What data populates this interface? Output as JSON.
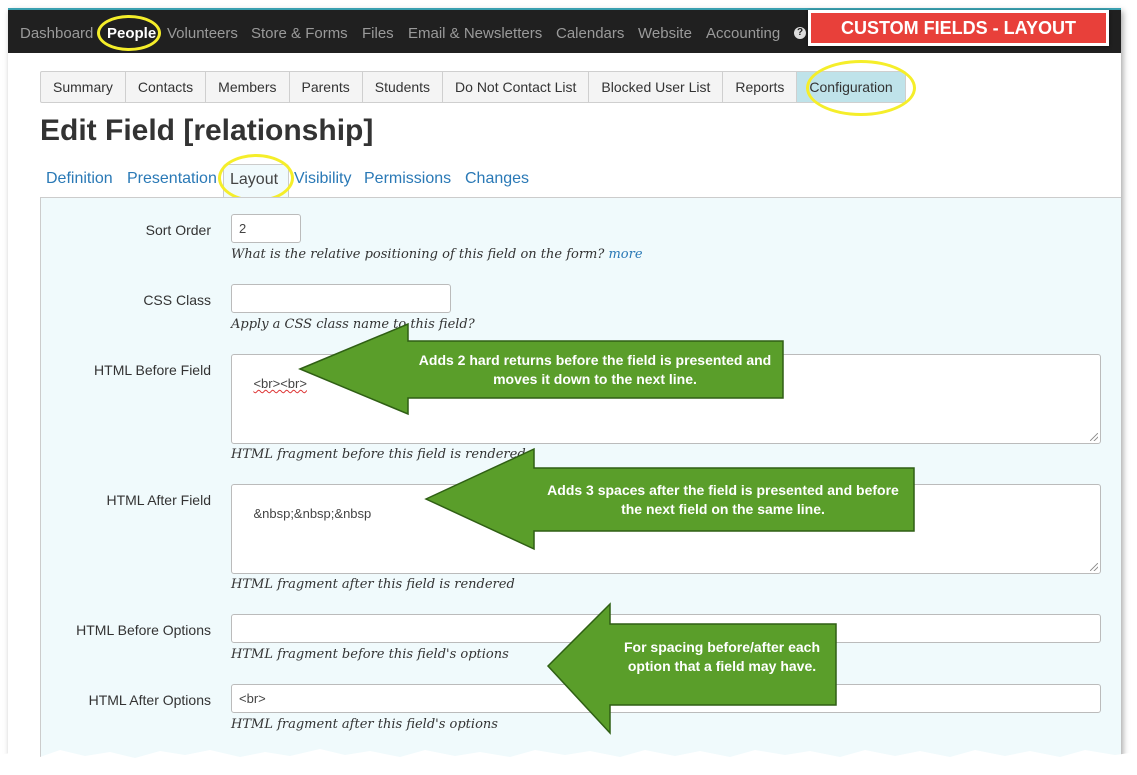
{
  "topnav": {
    "items": [
      "Dashboard",
      "People",
      "Volunteers",
      "Store & Forms",
      "Files",
      "Email & Newsletters",
      "Calendars",
      "Website",
      "Accounting"
    ],
    "active_index": 1,
    "help_glyph": "?"
  },
  "badge": {
    "title": "CUSTOM FIELDS - LAYOUT",
    "color": "#e8403a"
  },
  "subtabs": {
    "items": [
      "Summary",
      "Contacts",
      "Members",
      "Parents",
      "Students",
      "Do Not Contact List",
      "Blocked User List",
      "Reports",
      "Configuration"
    ],
    "active_index": 8
  },
  "page_title": "Edit Field [relationship]",
  "field_tabs": {
    "items": [
      "Definition",
      "Presentation",
      "Layout",
      "Visibility",
      "Permissions",
      "Changes"
    ],
    "active_index": 2
  },
  "form": {
    "sort_order": {
      "label": "Sort Order",
      "value": "2",
      "help": "What is the relative positioning of this field on the form?",
      "more_link": "more"
    },
    "css_class": {
      "label": "CSS Class",
      "value": "",
      "help": "Apply a CSS class name to this field?"
    },
    "html_before_field": {
      "label": "HTML Before Field",
      "value": "<br><br>",
      "help": "HTML fragment before this field is rendered"
    },
    "html_after_field": {
      "label": "HTML After Field",
      "value": "&nbsp;&nbsp;&nbsp",
      "help": "HTML fragment after this field is rendered"
    },
    "html_before_options": {
      "label": "HTML Before Options",
      "value": "",
      "help": "HTML fragment before this field's options"
    },
    "html_after_options": {
      "label": "HTML After Options",
      "value": "<br>",
      "help": "HTML fragment after this field's options"
    }
  },
  "callouts": {
    "before_field": "Adds 2 hard returns before the field is presented and moves it down to the next line.",
    "after_field": "Adds 3 spaces after the field is presented and before the next field on the same line.",
    "options": "For spacing before/after each option that a field may have.",
    "color": "#5a9e2a",
    "highlight_color": "#f5ee2a"
  }
}
